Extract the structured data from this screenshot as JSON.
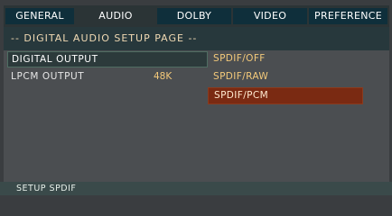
{
  "tabs": [
    {
      "label": "GENERAL"
    },
    {
      "label": "AUDIO",
      "active": true
    },
    {
      "label": "DOLBY"
    },
    {
      "label": "VIDEO"
    },
    {
      "label": "PREFERENCE"
    }
  ],
  "page": {
    "title": "-- DIGITAL AUDIO SETUP PAGE --"
  },
  "settings": [
    {
      "label": "DIGITAL OUTPUT",
      "selected": true
    },
    {
      "label": "LPCM OUTPUT",
      "value": "48K"
    }
  ],
  "options": [
    {
      "label": "SPDIF/OFF"
    },
    {
      "label": "SPDIF/RAW"
    },
    {
      "label": "SPDIF/PCM",
      "highlighted": true
    }
  ],
  "status": {
    "text": "SETUP SPDIF"
  },
  "colors": {
    "tab_inactive_bg": "#0f2f3b",
    "option_text": "#f3c97a",
    "option_highlight_bg": "#7a2a12"
  }
}
